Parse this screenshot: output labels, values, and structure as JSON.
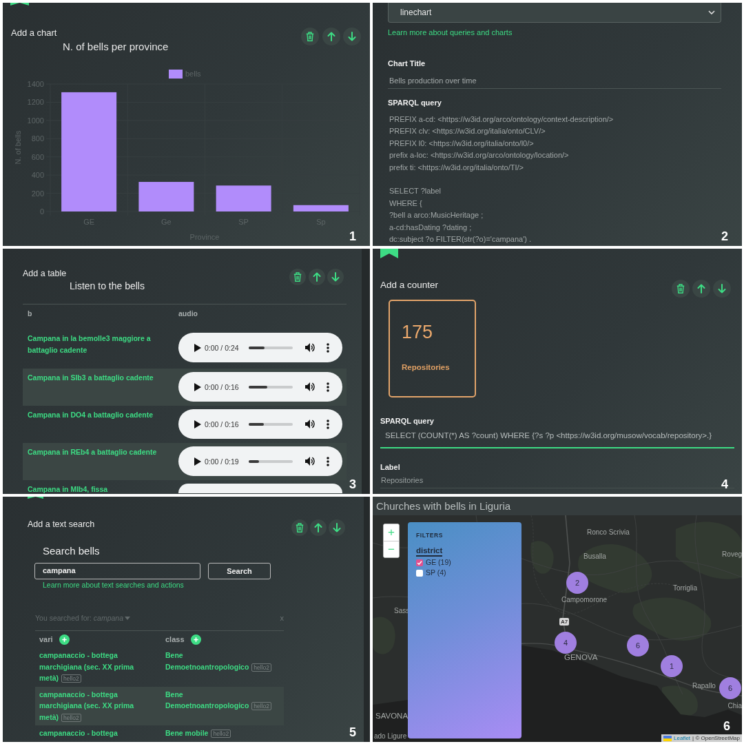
{
  "panels": [
    {
      "kind": "chart_block",
      "heading": "Add a chart",
      "chart_data": {
        "type": "bar",
        "title": "N. of bells per province",
        "xlabel": "Province",
        "ylabel": "N. of bells",
        "categories": [
          "GE",
          "Ge",
          "SP",
          "Sp"
        ],
        "series": [
          {
            "name": "bells",
            "color": "#b18cfb",
            "values": [
              1310,
              325,
              285,
              70
            ]
          }
        ],
        "ylim": [
          0,
          1400
        ],
        "yticks": [
          0,
          200,
          400,
          600,
          800,
          1000,
          1200,
          1400
        ],
        "grid": true
      },
      "panel_label": "1"
    },
    {
      "kind": "chart_form",
      "chart_type": "linechart",
      "help_link": "Learn more about queries and charts",
      "fields": [
        {
          "kind": "line",
          "label": "Chart Title",
          "value": "Bells production over time",
          "focused": false
        },
        {
          "kind": "multiline",
          "label": "SPARQL query",
          "value": "PREFIX a-cd: <https://w3id.org/arco/ontology/context-description/>\nPREFIX clv: <https://w3id.org/italia/onto/CLV/>\nPREFIX l0: <https://w3id.org/italia/onto/l0/>\nprefix a-loc: <https://w3id.org/arco/ontology/location/>\nprefix ti: <https://w3id.org/italia/onto/TI/>\n\nSELECT ?label\nWHERE {\n?bell a arco:MusicHeritage ;\na-cd:hasDating ?dating ;\ndc:subject ?o FILTER(str(?o)='campana') .",
          "focused": false
        }
      ],
      "panel_label": "2"
    },
    {
      "kind": "table_block",
      "heading": "Add a table",
      "table_title": "Listen to the bells",
      "columns": [
        "b",
        "audio"
      ],
      "rows": [
        {
          "label": "Campana in la bemolle3 maggiore a battaglio cadente",
          "audio": {
            "time": "0:00 / 0:24",
            "level": 0.37,
            "cut": false
          }
        },
        {
          "label": "Campana in SIb3 a battaglio cadente",
          "audio": {
            "time": "0:00 / 0:16",
            "level": 0.42,
            "cut": false
          }
        },
        {
          "label": "Campana in DO4 a battaglio cadente",
          "audio": {
            "time": "0:00 / 0:16",
            "level": 0.35,
            "cut": false
          }
        },
        {
          "label": "Campana in REb4 a battaglio cadente",
          "audio": {
            "time": "0:00 / 0:19",
            "level": 0.24,
            "cut": false
          }
        },
        {
          "label": "Campana in MIb4, fissa",
          "audio": {
            "cut": true
          }
        }
      ],
      "panel_label": "3"
    },
    {
      "kind": "counter_block",
      "heading": "Add a counter",
      "counter": {
        "value": "175",
        "label": "Repositories"
      },
      "fields": [
        {
          "kind": "line",
          "label": "SPARQL query",
          "value": "SELECT (COUNT(*) AS ?count) WHERE {?s ?p <https://w3id.org/musow/vocab/repository>.}",
          "focused": true
        },
        {
          "kind": "line",
          "label": "Label",
          "value": "Repositories",
          "focused": false
        }
      ],
      "panel_label": "4"
    },
    {
      "kind": "search_block",
      "heading": "Add a text search",
      "search_title": "Search bells",
      "query": "campana",
      "button": "Search",
      "help_link": "Learn more about text searches and actions",
      "summary": "You searched for: *campana*",
      "clear": "x",
      "columns": [
        "vari",
        "class"
      ],
      "rows": [
        {
          "cells": [
            {
              "text": "campanaccio - bottega marchigiana (sec. XX prima metà)",
              "tag": "hello2"
            },
            {
              "text": "Bene Demoetnoantropologico",
              "tag": "hello2"
            }
          ]
        },
        {
          "cells": [
            {
              "text": "campanaccio - bottega marchigiana (sec. XX prima metà)",
              "tag": "hello2"
            },
            {
              "text": "Bene Demoetnoantropologico",
              "tag": "hello2"
            }
          ]
        },
        {
          "cells": [
            {
              "text": "campanaccio - bottega"
            },
            {
              "text": "Bene mobile",
              "tag": "hello2"
            }
          ]
        }
      ],
      "panel_label": "5"
    },
    {
      "kind": "map_block",
      "title": "Churches with bells in Liguria",
      "zoom": [
        "+",
        "−"
      ],
      "filters": {
        "heading": "FILTERS",
        "groups": [
          {
            "name": "district",
            "options": [
              {
                "label": "GE (19)",
                "checked": true
              },
              {
                "label": "SP (4)",
                "checked": false
              }
            ]
          }
        ]
      },
      "places": [
        "Ronco Scrivia",
        "Busalla",
        "Campomorone",
        "Torriglia",
        "Roveg",
        "Sass",
        "GENOVA",
        "Rapallo",
        "Chia",
        "SAVONA",
        "ado Ligure"
      ],
      "road_sign": "A7",
      "clusters": [
        "2",
        "4",
        "6",
        "1",
        "6"
      ],
      "attribution": {
        "link": "Leaflet",
        "text": "| © OpenStreetMap"
      },
      "panel_label": "6"
    }
  ]
}
